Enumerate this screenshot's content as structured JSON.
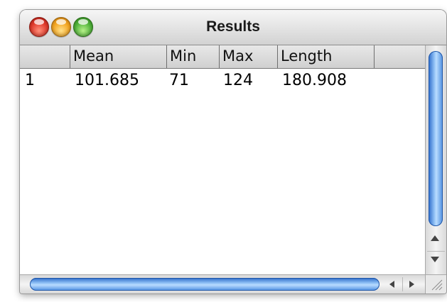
{
  "window": {
    "title": "Results"
  },
  "table": {
    "columns": [
      "",
      "Mean",
      "Min",
      "Max",
      "Length"
    ],
    "rows": [
      {
        "label": "1",
        "mean": "101.685",
        "min": "71",
        "max": "124",
        "length": "180.908"
      }
    ]
  },
  "colors": {
    "scroll_thumb": "#4d8ee0",
    "close": "#e0392b",
    "minimize": "#f4a521",
    "zoom": "#4fb23a"
  },
  "icons": [
    "close-icon",
    "minimize-icon",
    "zoom-icon",
    "scroll-up-icon",
    "scroll-down-icon",
    "scroll-left-icon",
    "scroll-right-icon",
    "resize-grip-icon"
  ]
}
